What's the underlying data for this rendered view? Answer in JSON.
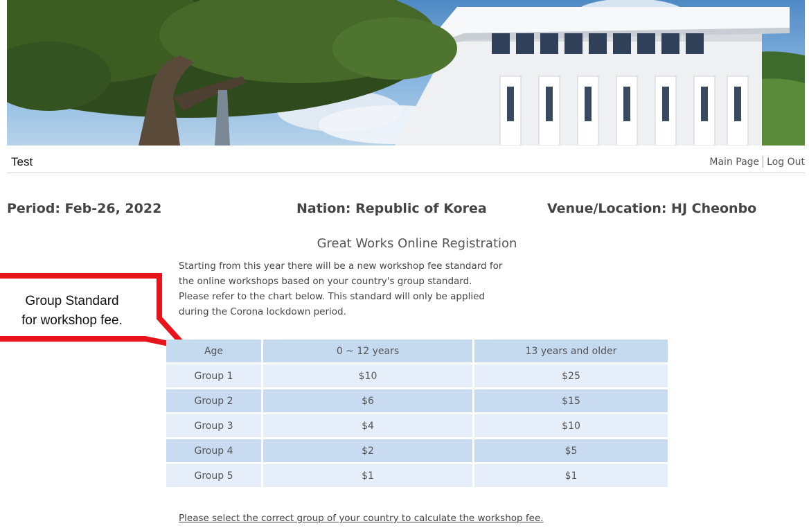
{
  "header": {
    "site_name": "Test",
    "links": [
      {
        "label": "Main Page"
      },
      {
        "label": "Log Out"
      }
    ]
  },
  "info": {
    "period": "Period: Feb-26, 2022",
    "nation": "Nation: Republic of Korea",
    "venue": "Venue/Location: HJ Cheonbo"
  },
  "main": {
    "title": "Great Works Online Registration",
    "intro": "Starting from this year there will be a new workshop fee standard for the online workshops based on your country's group standard. Please refer to the chart below. This standard will only be applied during the Corona lockdown period.",
    "callout": {
      "line1": "Group Standard",
      "line2": "for workshop fee.",
      "border_color": "#e8141b"
    },
    "fee_table": {
      "headers": [
        "Age",
        "0 ~ 12 years",
        "13 years and older"
      ],
      "rows": [
        [
          "Group 1",
          "$10",
          "$25"
        ],
        [
          "Group 2",
          "$6",
          "$15"
        ],
        [
          "Group 3",
          "$4",
          "$10"
        ],
        [
          "Group 4",
          "$2",
          "$5"
        ],
        [
          "Group 5",
          "$1",
          "$1"
        ]
      ]
    },
    "select_note": "Please select the correct group of your country to calculate the workshop fee."
  },
  "colors": {
    "table_header_bg": "#c5d9ef",
    "table_row_light": "#e6eff9",
    "table_row_dark": "#c8dbf0",
    "callout_red": "#e8141b"
  }
}
